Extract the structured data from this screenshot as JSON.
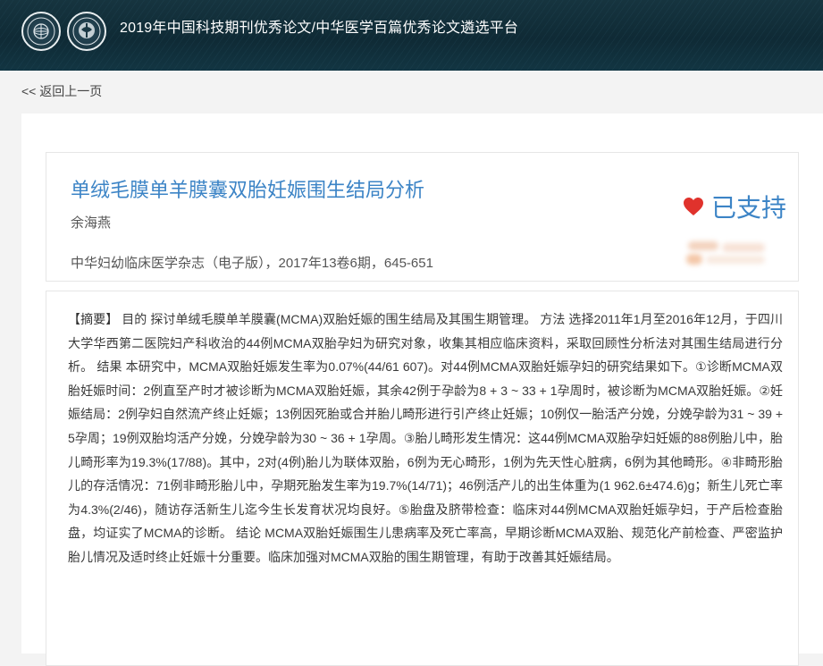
{
  "header": {
    "site_title": "2019年中国科技期刊优秀论文/中华医学百篇优秀论文遴选平台",
    "logo_left": "china-science-journal-logo",
    "logo_right": "chinese-medical-association-logo",
    "bg_color": "#123542"
  },
  "nav": {
    "back_label": "<< 返回上一页"
  },
  "article": {
    "title": "单绒毛膜单羊膜囊双胎妊娠围生结局分析",
    "author": "余海燕",
    "source": "中华妇幼临床医学杂志（电子版），2017年13卷6期，645-651",
    "support_label": "已支持",
    "support_icon": "heart-icon",
    "accent_color": "#3c84c6",
    "heart_color": "#e0322c"
  },
  "abstract": {
    "tag": "【摘要】",
    "text": " 目的 探讨单绒毛膜单羊膜囊(MCMA)双胎妊娠的围生结局及其围生期管理。 方法 选择2011年1月至2016年12月，于四川大学华西第二医院妇产科收治的44例MCMA双胎孕妇为研究对象，收集其相应临床资料，采取回顾性分析法对其围生结局进行分析。 结果 本研究中，MCMA双胎妊娠发生率为0.07%(44/61 607)。对44例MCMA双胎妊娠孕妇的研究结果如下。①诊断MCMA双胎妊娠时间：2例直至产时才被诊断为MCMA双胎妊娠，其余42例于孕龄为8 + 3 ~ 33 + 1孕周时，被诊断为MCMA双胎妊娠。②妊娠结局：2例孕妇自然流产终止妊娠；13例因死胎或合并胎儿畸形进行引产终止妊娠；10例仅一胎活产分娩，分娩孕龄为31 ~ 39 + 5孕周；19例双胎均活产分娩，分娩孕龄为30 ~ 36 + 1孕周。③胎儿畸形发生情况：这44例MCMA双胎孕妇妊娠的88例胎儿中，胎儿畸形率为19.3%(17/88)。其中，2对(4例)胎儿为联体双胎，6例为无心畸形，1例为先天性心脏病，6例为其他畸形。④非畸形胎儿的存活情况：71例非畸形胎儿中，孕期死胎发生率为19.7%(14/71)；46例活产儿的出生体重为(1 962.6±474.6)g；新生儿死亡率为4.3%(2/46)，随访存活新生儿迄今生长发育状况均良好。⑤胎盘及脐带检查：临床对44例MCMA双胎妊娠孕妇，于产后检查胎盘，均证实了MCMA的诊断。 结论 MCMA双胎妊娠围生儿患病率及死亡率高，早期诊断MCMA双胎、规范化产前检查、严密监护胎儿情况及适时终止妊娠十分重要。临床加强对MCMA双胎的围生期管理，有助于改善其妊娠结局。"
  }
}
